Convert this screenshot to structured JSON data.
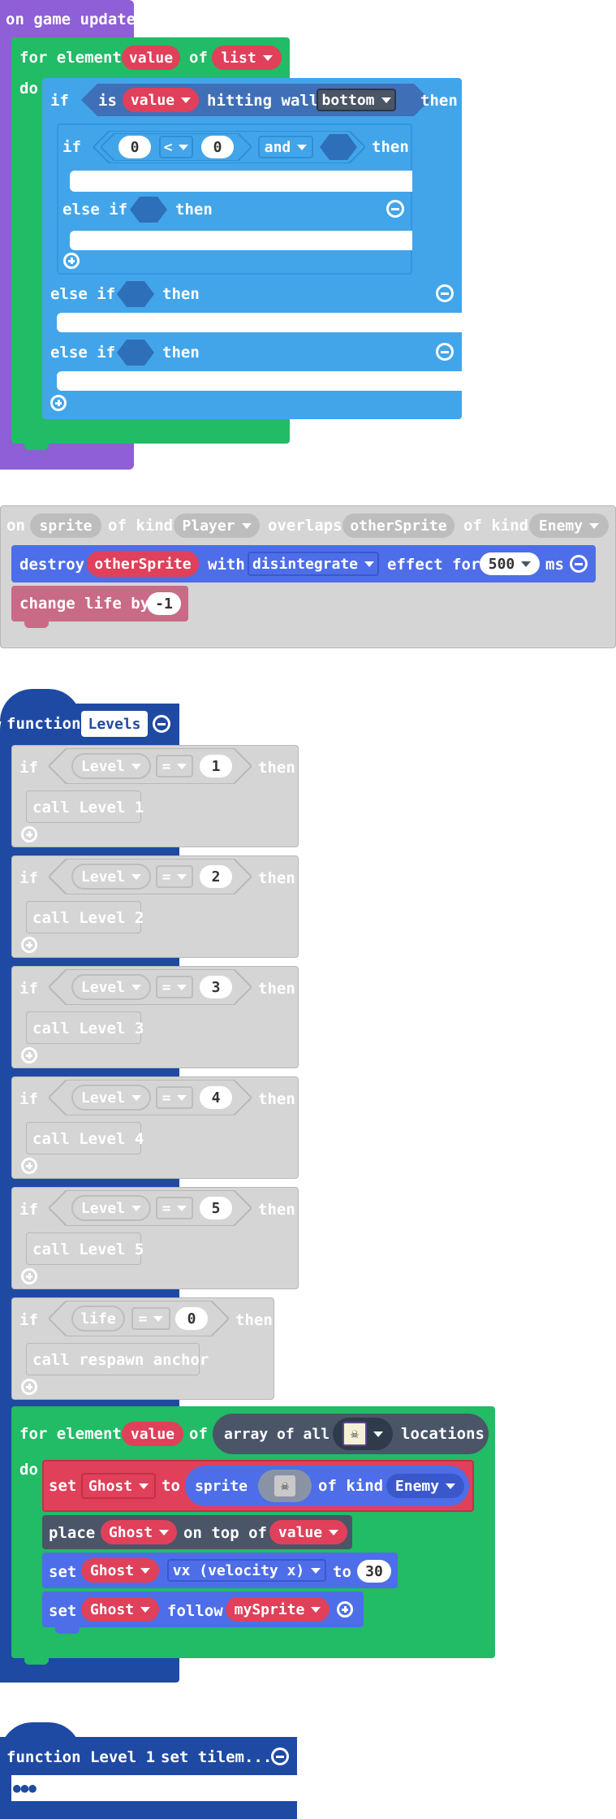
{
  "colors": {
    "purple": "#8e5fd6",
    "green": "#22bb66",
    "lightblue": "#42a5ea",
    "blue": "#4d6ee8",
    "red": "#e0405a",
    "darkgray": "#4a5568",
    "gray": "#d5d5d5",
    "navy": "#1f4aa3",
    "pink": "#c96a86"
  },
  "game_update": {
    "hat": "on game update",
    "for_label": "for element",
    "var": "value",
    "of": "of",
    "list": "list",
    "do": "do",
    "if": "if",
    "is": "is",
    "value": "value",
    "hitting_wall": "hitting wall",
    "wall": "bottom",
    "then": "then",
    "inner_if": "if",
    "num_a": "0",
    "op": "<",
    "num_b": "0",
    "and": "and",
    "else_if": "else if"
  },
  "overlap": {
    "on": "on",
    "sprite": "sprite",
    "of_kind": "of kind",
    "kind1": "Player",
    "overlaps": "overlaps",
    "other": "otherSprite",
    "kind2": "Enemy",
    "destroy": "destroy",
    "with": "with",
    "effect_name": "disintegrate",
    "effect_for": "effect for",
    "ms_val": "500",
    "ms": "ms",
    "change_life": "change life by",
    "life_val": "-1"
  },
  "levels_fn": {
    "function": "function",
    "name": "Levels",
    "rows": [
      {
        "if": "if",
        "var": "Level",
        "op": "=",
        "val": "1",
        "then": "then",
        "call": "call Level 1"
      },
      {
        "if": "if",
        "var": "Level",
        "op": "=",
        "val": "2",
        "then": "then",
        "call": "call Level 2"
      },
      {
        "if": "if",
        "var": "Level",
        "op": "=",
        "val": "3",
        "then": "then",
        "call": "call Level 3"
      },
      {
        "if": "if",
        "var": "Level",
        "op": "=",
        "val": "4",
        "then": "then",
        "call": "call Level 4"
      },
      {
        "if": "if",
        "var": "Level",
        "op": "=",
        "val": "5",
        "then": "then",
        "call": "call Level 5"
      },
      {
        "if": "if",
        "var": "life",
        "op": "=",
        "val": "0",
        "then": "then",
        "call": "call respawn anchor"
      }
    ],
    "for_label": "for element",
    "for_var": "value",
    "of": "of",
    "array": "array of all",
    "locations": "locations",
    "do": "do",
    "set": "set",
    "ghost": "Ghost",
    "to": "to",
    "sprite": "sprite",
    "of_kind": "of kind",
    "enemy": "Enemy",
    "place": "place",
    "on_top_of": "on top of",
    "value": "value",
    "vx": "vx (velocity x)",
    "vx_val": "30",
    "follow": "follow",
    "my_sprite": "mySprite"
  },
  "level1_fn": {
    "function": "function Level 1",
    "body": "set tilem...",
    "dots": "●●●"
  }
}
